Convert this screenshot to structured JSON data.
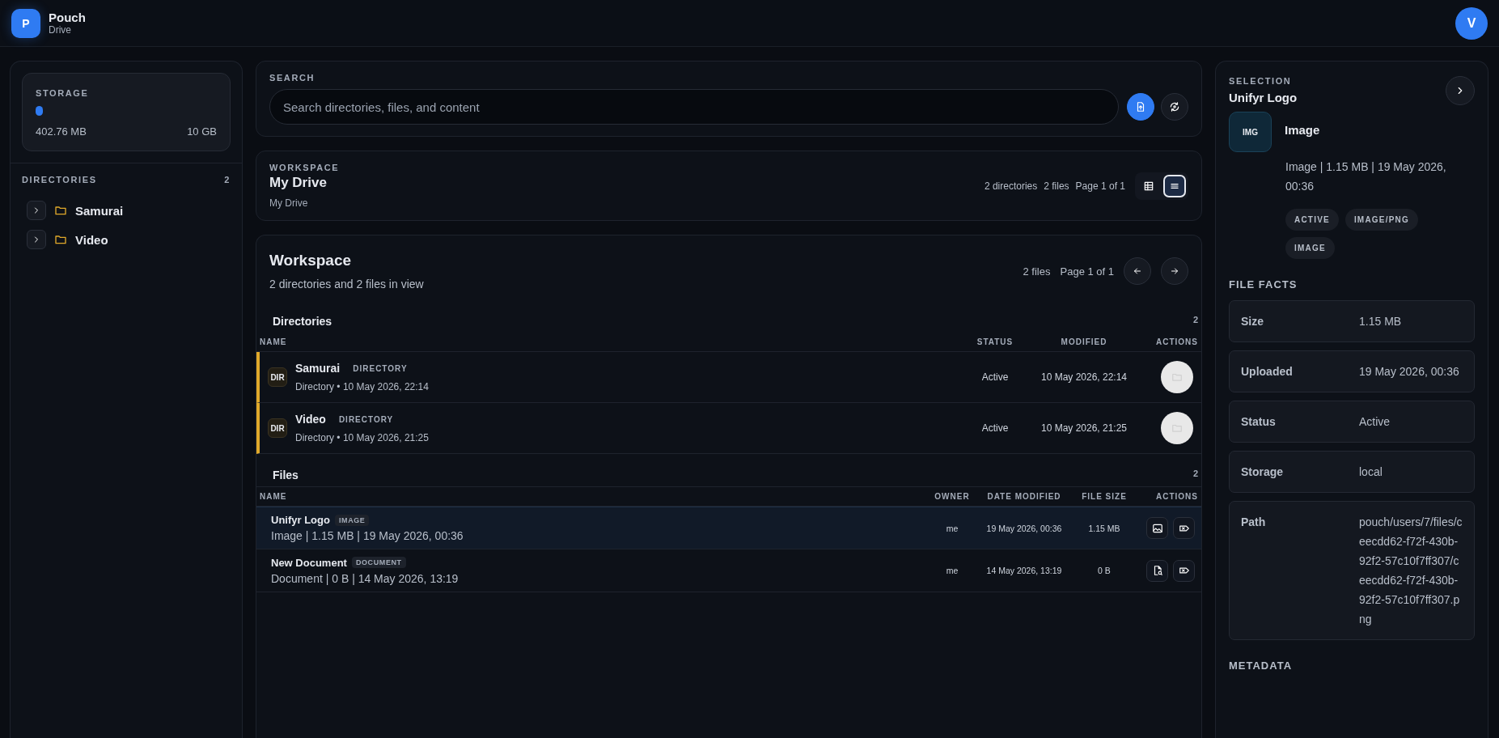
{
  "app": {
    "logo": "P",
    "name": "Pouch",
    "subtitle": "Drive",
    "avatar": "V"
  },
  "sidebar": {
    "storage": {
      "label": "STORAGE",
      "level": 0.04,
      "used": "402.76 MB",
      "total": "10 GB"
    },
    "directories": {
      "label": "DIRECTORIES",
      "count": "2",
      "items": [
        {
          "name": "Samurai",
          "expanded": false
        },
        {
          "name": "Video",
          "expanded": false
        }
      ]
    }
  },
  "search": {
    "label": "SEARCH",
    "placeholder": "Search directories, files, and content"
  },
  "workspace": {
    "label": "WORKSPACE",
    "title": "My Drive",
    "breadcrumb": "My Drive",
    "stats": [
      "2 directories",
      "2 files",
      "Page 1 of 1"
    ],
    "views": [
      {
        "kind": "grid",
        "selected": false
      },
      {
        "kind": "list",
        "selected": true
      }
    ]
  },
  "listing": {
    "title": "Workspace",
    "subtitle": "2 directories and 2 files in view",
    "stats": [
      "2 files",
      "Page 1 of 1"
    ],
    "directories": {
      "title": "Directories",
      "count": "2",
      "columns": [
        "NAME",
        "STATUS",
        "MODIFIED",
        "ACTIONS"
      ],
      "rows": [
        {
          "badge": "DIR",
          "name": "Samurai",
          "tag": "DIRECTORY",
          "meta": "Directory • 10 May 2026, 22:14",
          "status": "Active",
          "modified": "10 May 2026, 22:14"
        },
        {
          "badge": "DIR",
          "name": "Video",
          "tag": "DIRECTORY",
          "meta": "Directory • 10 May 2026, 21:25",
          "status": "Active",
          "modified": "10 May 2026, 21:25"
        }
      ]
    },
    "files": {
      "title": "Files",
      "count": "2",
      "columns": [
        "NAME",
        "OWNER",
        "DATE MODIFIED",
        "FILE SIZE",
        "ACTIONS"
      ],
      "rows": [
        {
          "kind": "image",
          "name": "Unifyr Logo",
          "tag": "IMAGE",
          "meta": "Image | 1.15 MB | 19 May 2026, 00:36",
          "owner": "me",
          "modified": "19 May 2026, 00:36",
          "size": "1.15 MB",
          "selected": true
        },
        {
          "kind": "document",
          "name": "New Document",
          "tag": "DOCUMENT",
          "meta": "Document | 0 B | 14 May 2026, 13:19",
          "owner": "me",
          "modified": "14 May 2026, 13:19",
          "size": "0 B",
          "selected": false
        }
      ]
    }
  },
  "selection": {
    "label": "SELECTION",
    "title": "Unifyr Logo",
    "badge": "IMG",
    "type": "Image",
    "meta": "Image | 1.15 MB | 19 May 2026, 00:36",
    "tags": [
      "ACTIVE",
      "IMAGE/PNG",
      "IMAGE"
    ],
    "facts_title": "FILE FACTS",
    "facts": [
      {
        "label": "Size",
        "value": "1.15 MB"
      },
      {
        "label": "Uploaded",
        "value": "19 May 2026, 00:36"
      },
      {
        "label": "Status",
        "value": "Active"
      },
      {
        "label": "Storage",
        "value": "local"
      },
      {
        "label": "Path",
        "value": "pouch/users/7/files/ceecdd62-f72f-430b-92f2-57c10f7ff307/ceecdd62-f72f-430b-92f2-57c10f7ff307.png"
      }
    ],
    "metadata_title": "METADATA"
  }
}
